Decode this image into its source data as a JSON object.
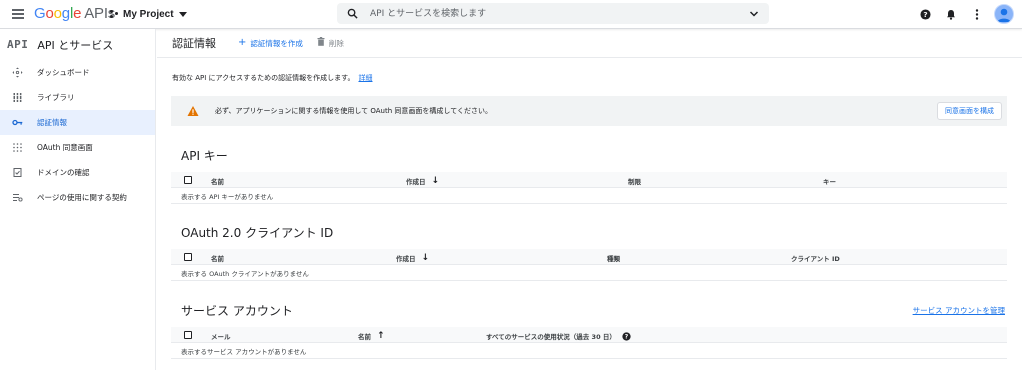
{
  "topbar": {
    "logo_google": [
      "G",
      "o",
      "o",
      "g",
      "l",
      "e"
    ],
    "logo_apis": "APIs",
    "project_name": "My Project",
    "search_placeholder": "API とサービスを検索します"
  },
  "sidebar": {
    "logo": "API",
    "title": "API とサービス",
    "items": [
      {
        "label": "ダッシュボード",
        "icon": "dashboard-icon"
      },
      {
        "label": "ライブラリ",
        "icon": "library-icon"
      },
      {
        "label": "認証情報",
        "icon": "key-icon",
        "active": true
      },
      {
        "label": "OAuth 同意画面",
        "icon": "consent-icon"
      },
      {
        "label": "ドメインの確認",
        "icon": "domain-verify-icon"
      },
      {
        "label": "ページの使用に関する契約",
        "icon": "agreement-icon"
      }
    ]
  },
  "main": {
    "title": "認証情報",
    "create_label": "認証情報を作成",
    "delete_label": "削除",
    "intro_text": "有効な API にアクセスするための認証情報を作成します。",
    "intro_link": "詳細",
    "warning_text": "必ず、アプリケーションに関する情報を使用して OAuth 同意画面を構成してください。",
    "warning_button": "同意画面を構成",
    "api_keys": {
      "title": "API キー",
      "columns": {
        "name": "名前",
        "created": "作成日",
        "restriction": "制限",
        "key": "キー"
      },
      "empty": "表示する API キーがありません"
    },
    "oauth": {
      "title": "OAuth 2.0 クライアント ID",
      "columns": {
        "name": "名前",
        "created": "作成日",
        "type": "種類",
        "client_id": "クライアント ID"
      },
      "empty": "表示する OAuth クライアントがありません"
    },
    "service_accounts": {
      "title": "サービス アカウント",
      "manage_link": "サービス アカウントを管理",
      "columns": {
        "email": "メール",
        "name": "名前",
        "usage": "すべてのサービスの使用状況（過去 30 日）"
      },
      "empty": "表示するサービス アカウントがありません"
    }
  },
  "colors": {
    "accent": "#1a73e8",
    "warning": "#e37400",
    "active_bg": "#e8f0fe"
  }
}
